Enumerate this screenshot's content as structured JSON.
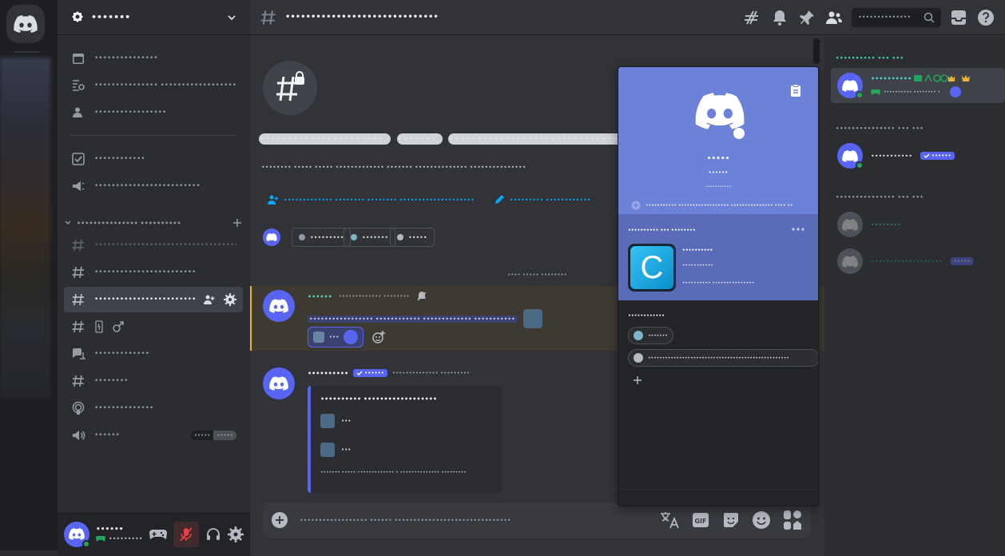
{
  "server": {
    "name": "•••••••"
  },
  "sidebar": {
    "items": [
      {
        "label": "•••••••••••••••",
        "icon": "calendar-icon"
      },
      {
        "label": "•••••••••••••••  ••••••••••••••••••••••••",
        "icon": "browse-channels-icon"
      },
      {
        "label": "•••••••••••••••••",
        "icon": "members-icon"
      },
      {
        "label": "••••••••••••",
        "icon": "checkbox-icon"
      },
      {
        "label": "•••••••••••••••••••••••••",
        "icon": "boost-icon"
      }
    ],
    "category": "•••••••••••••••  ••••••••••",
    "channels": [
      {
        "label": "••••••••••••••••••••••••••••••••••••••",
        "icon": "hashtag-icon",
        "muted": true
      },
      {
        "label": "••••••••••••••••••••••••",
        "icon": "hashtag-icon"
      },
      {
        "label": "•••••••••••••••••••••••••••",
        "icon": "hashtag-lock-icon",
        "active": true
      },
      {
        "label": "",
        "icon": "hashtag-icon"
      },
      {
        "label": "•••••••••••••",
        "icon": "forum-icon"
      },
      {
        "label": "••••••••",
        "icon": "hashtag-icon"
      },
      {
        "label": "••••••••••••••",
        "icon": "stage-icon"
      },
      {
        "label": "••••••",
        "icon": "speaker-icon",
        "count1": "•••••",
        "count2": "•••••"
      }
    ]
  },
  "user": {
    "name": "••••••",
    "status": "•••••••••"
  },
  "topbar": {
    "title": "••••••••••••••••••••••••••••••",
    "search_placeholder": "••••••••••••••"
  },
  "main": {
    "welcome_title": [
      "••••••••••••••••••••••",
      "•••••••",
      "••••••••••••••••••••••••••••••••"
    ],
    "welcome_desc": "••••••••  •••••  •••••  •••••••••••••  •••••••  ••••••••••••••  •••••••••••••••",
    "links": [
      "•••••••••••••  ••••••••  ••••••••  ••••••••••••••••••••",
      "•••••••••  ••••••••••••"
    ],
    "tags": [
      "•••••••••",
      "•••••••",
      "•••••"
    ],
    "date_divider": "••••  •••••  ••••••••",
    "message1": {
      "author": "••••••",
      "time": "•••••••••••••  ••••••••",
      "line": "•••••••••••••••••  ••••••••••••  •••••••••••••  •••••••••••",
      "reaction": "•••"
    },
    "message2": {
      "author": "••••••••••",
      "badge": "••••••",
      "time": "••••••••••••••  •••••••••",
      "embed_title": "••••••••••  ••••••••••••••••••",
      "row1": "•••",
      "row2": "•••",
      "footer": "•••••••  •••••  •••••••••••••  •  ••••••••••••••  •••••••••"
    },
    "composer_placeholder": "••••••••••••••••••  ••••••  •••••••••••••••••••••••••••••••"
  },
  "popup": {
    "name": "•••••",
    "tag": "••••••",
    "pronouns": "•••••••••••",
    "roles_line": "•••••••••••  ••••••••••••••••••  •••••••••••••••  ••••  ••",
    "activity_header": "••••••••••  •••  ••••••••",
    "game_title": "••••••••••",
    "game_detail": "•••••••••••",
    "game_time": "••••••••••  •••••••••••••••",
    "game_letter": "C",
    "roles_header": "••••••••••••",
    "role1": "•••••••",
    "role2": "••••••••••••••••••••••••••••••••••••••••••••••••••"
  },
  "members": {
    "groups": [
      {
        "label": "••••••••••  •••  •••",
        "members": [
          {
            "name": "••••••••••",
            "sub": "••••••••••  ••••••••  •",
            "status": "online"
          }
        ]
      },
      {
        "label": "•••••••••••••••  •••  •••",
        "members": [
          {
            "name": "•••••••••••",
            "badge": "••••••",
            "status": "online"
          }
        ]
      },
      {
        "label": "•••••••••••••••  •••  •••",
        "members": [
          {
            "name": "••••••••",
            "status": "offline"
          },
          {
            "name": "•••••••••••••••••••",
            "badge": "•••••",
            "status": "offline"
          }
        ]
      }
    ]
  },
  "colors": {
    "blurple": "#5865f2",
    "online": "#23a55a",
    "mention_bg": "#444039",
    "mention_bar": "#f0b232",
    "banner": "#6c81d8",
    "muted_red": "#f23f43"
  }
}
